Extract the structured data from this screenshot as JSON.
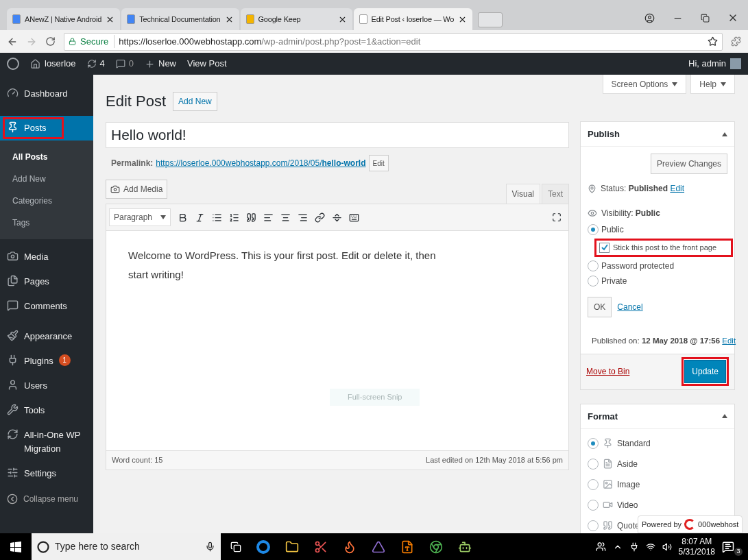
{
  "browser": {
    "tabs": [
      {
        "title": "ANewZ | Native Android",
        "selected": false,
        "color": "#4285f4"
      },
      {
        "title": "Technical Documentation",
        "selected": false,
        "color": "#4285f4"
      },
      {
        "title": "Google Keep",
        "selected": false,
        "color": "#f4b400"
      },
      {
        "title": "Edit Post ‹ loserloe — Wo",
        "selected": true,
        "color": "#ffffff"
      }
    ],
    "secure": "Secure",
    "url_host": "https://loserloe.000webhostapp.com",
    "url_path": "/wp-admin/post.php?post=1&action=edit"
  },
  "admin_bar": {
    "site": "loserloe",
    "updates": "4",
    "comments": "0",
    "new": "New",
    "view": "View Post",
    "greeting": "Hi, admin"
  },
  "sidebar": {
    "items": [
      {
        "label": "Dashboard",
        "selected": false,
        "highlighted": false
      },
      {
        "label": "Posts",
        "selected": true,
        "highlighted": true,
        "children": [
          {
            "label": "All Posts",
            "selected": true
          },
          {
            "label": "Add New",
            "selected": false
          },
          {
            "label": "Categories",
            "selected": false
          },
          {
            "label": "Tags",
            "selected": false
          }
        ]
      },
      {
        "label": "Media",
        "selected": false,
        "highlighted": false
      },
      {
        "label": "Pages",
        "selected": false,
        "highlighted": false
      },
      {
        "label": "Comments",
        "selected": false,
        "highlighted": false
      },
      {
        "label": "Appearance",
        "selected": false,
        "highlighted": false
      },
      {
        "label": "Plugins",
        "selected": false,
        "highlighted": false,
        "badge": "1"
      },
      {
        "label": "Users",
        "selected": false,
        "highlighted": false
      },
      {
        "label": "Tools",
        "selected": false,
        "highlighted": false
      },
      {
        "label": "All-in-One WP Migration",
        "selected": false,
        "highlighted": false
      },
      {
        "label": "Settings",
        "selected": false,
        "highlighted": false
      }
    ],
    "collapse": "Collapse menu"
  },
  "header": {
    "screen_options": "Screen Options",
    "help": "Help",
    "title": "Edit Post",
    "add_new": "Add New"
  },
  "editor": {
    "post_title": "Hello world!",
    "permalink_label": "Permalink:",
    "permalink_base": "https://loserloe.000webhostapp.com/2018/05/",
    "permalink_slug": "hello-world",
    "permalink_edit": "Edit",
    "add_media": "Add Media",
    "tabs": [
      {
        "label": "Visual",
        "selected": true
      },
      {
        "label": "Text",
        "selected": false
      }
    ],
    "format_select": "Paragraph",
    "content": "Welcome to WordPress. This is your first post. Edit or delete it, then start writing!",
    "snip_hint": "Full-screen Snip",
    "word_count": "Word count: 15",
    "last_edited": "Last edited on 12th May 2018 at 5:56 pm"
  },
  "publish": {
    "title": "Publish",
    "preview": "Preview Changes",
    "status_label": "Status:",
    "status_value": "Published",
    "status_edit": "Edit",
    "visibility_label": "Visibility:",
    "visibility_value": "Public",
    "options": [
      {
        "label": "Public",
        "selected": true
      },
      {
        "label": "Password protected",
        "selected": false
      },
      {
        "label": "Private",
        "selected": false
      }
    ],
    "sticky": {
      "label": "Stick this post to the front page",
      "checked": true,
      "highlighted": true
    },
    "ok": "OK",
    "cancel": "Cancel",
    "published_label": "Published on:",
    "published_value": "12 May 2018 @ 17:56",
    "published_edit": "Edit",
    "trash": "Move to Bin",
    "update": {
      "label": "Update",
      "highlighted": true
    }
  },
  "format": {
    "title": "Format",
    "options": [
      {
        "label": "Standard",
        "selected": true
      },
      {
        "label": "Aside",
        "selected": false
      },
      {
        "label": "Image",
        "selected": false
      },
      {
        "label": "Video",
        "selected": false
      },
      {
        "label": "Quote",
        "selected": false
      }
    ]
  },
  "powered": {
    "prefix": "Powered by",
    "brand": "000webhost"
  },
  "taskbar": {
    "search_placeholder": "Type here to search",
    "time": "8:07 AM",
    "date": "5/31/2018",
    "notifications": "3"
  }
}
